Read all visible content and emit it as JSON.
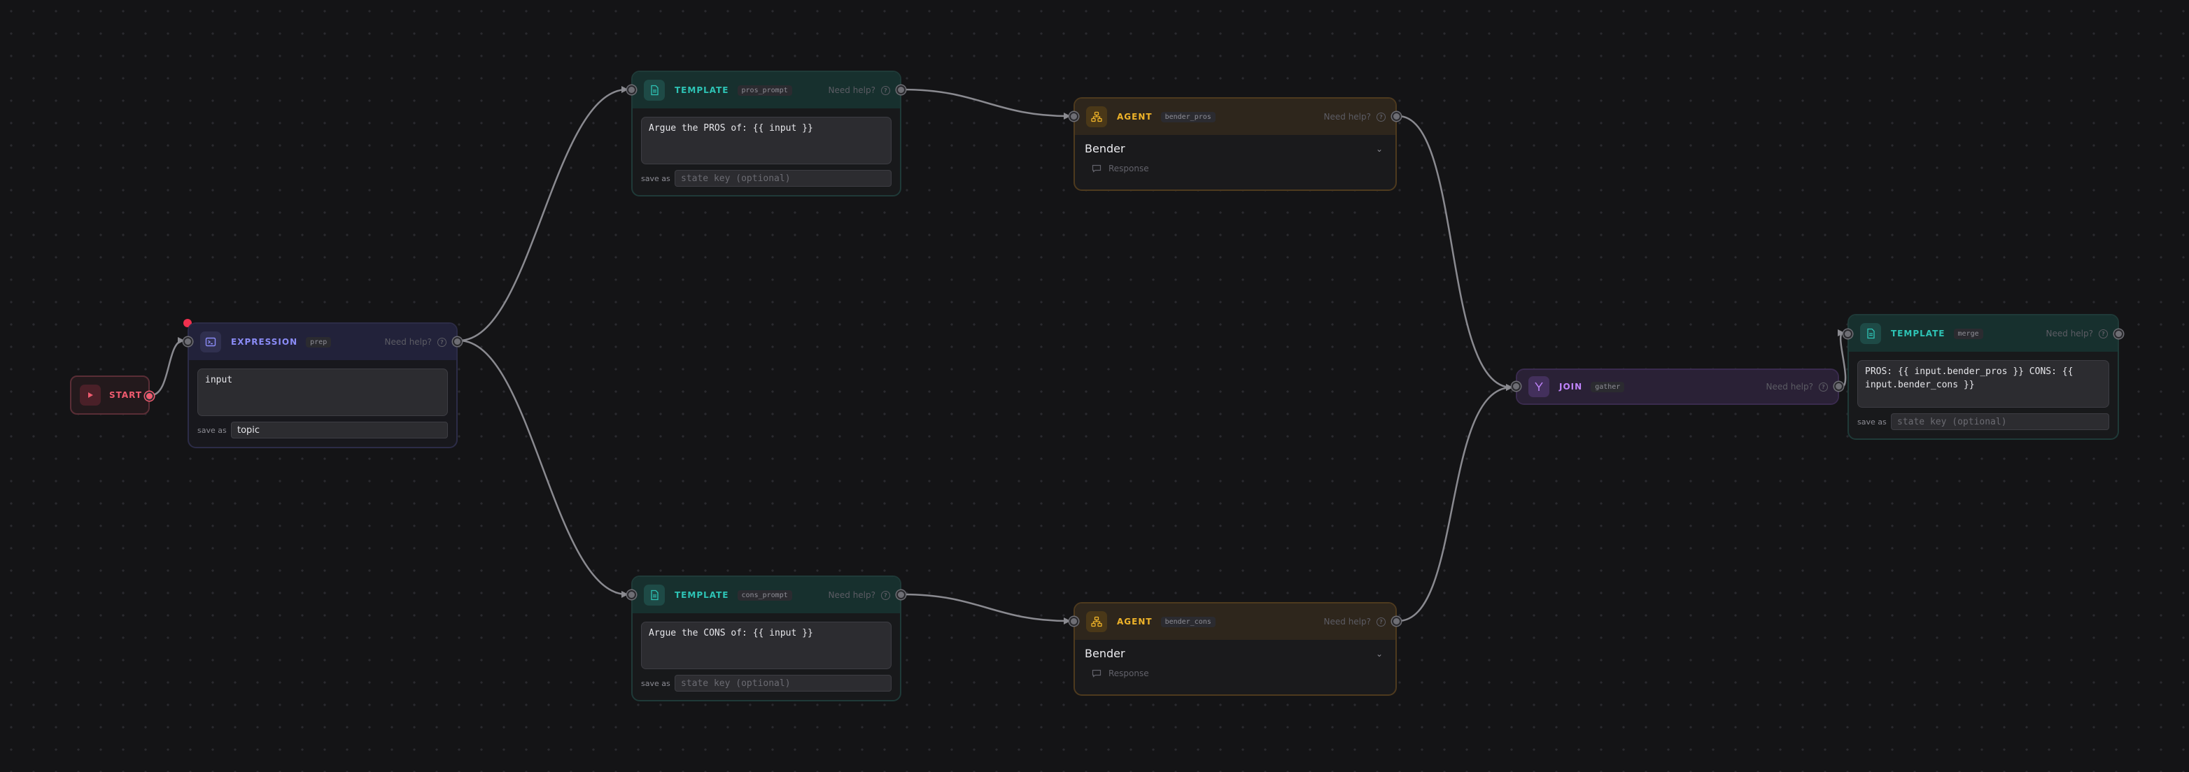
{
  "colors": {
    "background": "#141416",
    "edge": "#8a8a90",
    "template_accent": "#2ec4b6",
    "agent_accent": "#f0b429",
    "expression_accent": "#8b8cf7",
    "join_accent": "#c084fc",
    "start_accent": "#ef5b6f",
    "error_dot": "#f0304e"
  },
  "help_text": "Need help?",
  "save_as_label": "save as",
  "nodes": {
    "start": {
      "title": "START",
      "icon": "play-icon"
    },
    "expression": {
      "title": "EXPRESSION",
      "tag": "prep",
      "icon": "terminal-icon",
      "code": "input",
      "save_value": "topic",
      "has_error": true
    },
    "template_pros": {
      "title": "TEMPLATE",
      "tag": "pros_prompt",
      "icon": "file-text-icon",
      "code": "Argue the PROS of: {{ input }}",
      "save_placeholder": "state key (optional)"
    },
    "template_cons": {
      "title": "TEMPLATE",
      "tag": "cons_prompt",
      "icon": "file-text-icon",
      "code": "Argue the CONS of: {{ input }}",
      "save_placeholder": "state key (optional)"
    },
    "agent_pros": {
      "title": "AGENT",
      "tag": "bender_pros",
      "icon": "network-icon",
      "agent_name": "Bender",
      "response_label": "Response"
    },
    "agent_cons": {
      "title": "AGENT",
      "tag": "bender_cons",
      "icon": "network-icon",
      "agent_name": "Bender",
      "response_label": "Response"
    },
    "join": {
      "title": "JOIN",
      "tag": "gather",
      "icon": "merge-icon"
    },
    "template_merge": {
      "title": "TEMPLATE",
      "tag": "merge",
      "icon": "file-text-icon",
      "code": "PROS: {{ input.bender_pros }} CONS: {{ input.bender_cons }}",
      "save_placeholder": "state key (optional)"
    }
  }
}
